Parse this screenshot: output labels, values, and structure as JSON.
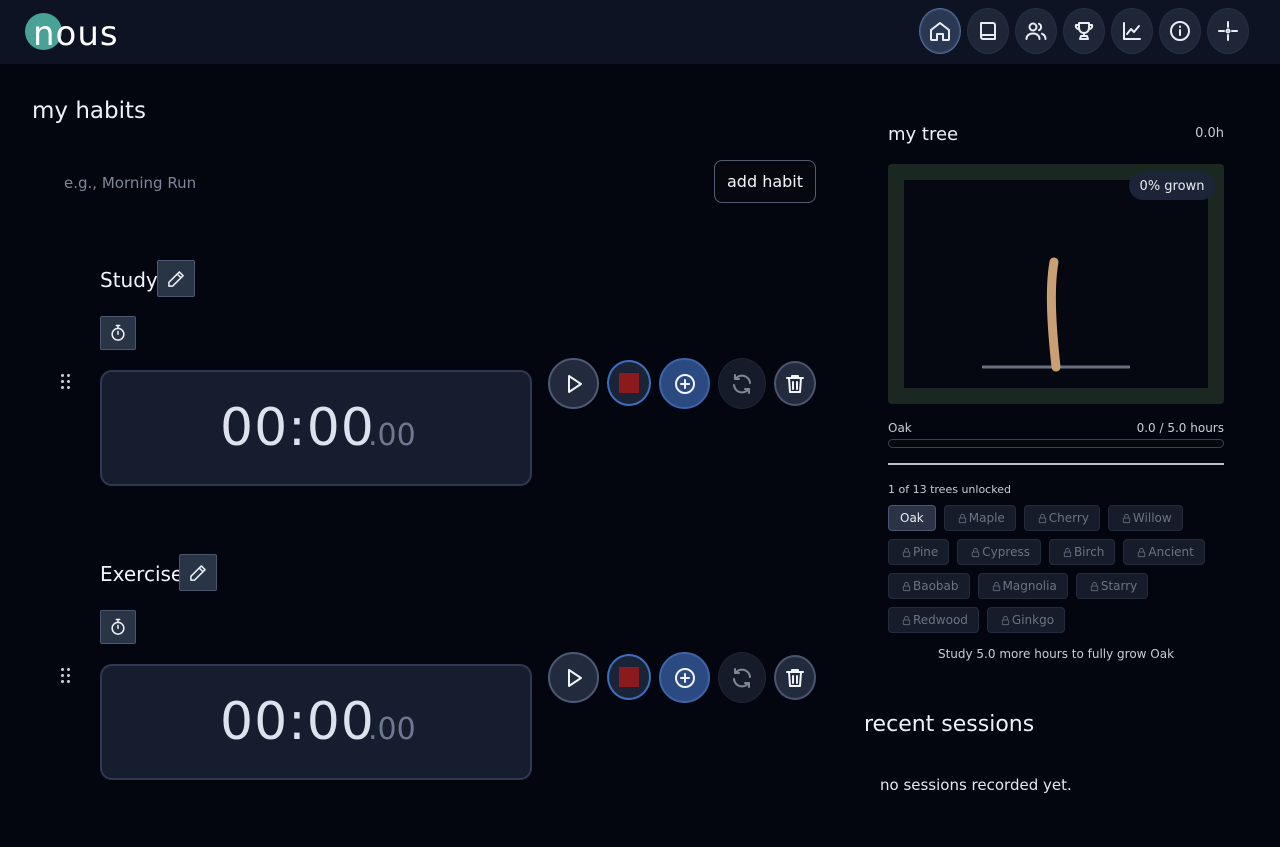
{
  "app": {
    "logo": "nous",
    "accent": "#4fb3a3"
  },
  "nav": [
    {
      "id": "home",
      "icon": "home-icon",
      "active": true
    },
    {
      "id": "journal",
      "icon": "book-icon",
      "active": false
    },
    {
      "id": "friends",
      "icon": "users-icon",
      "active": false
    },
    {
      "id": "achievements",
      "icon": "trophy-icon",
      "active": false
    },
    {
      "id": "stats",
      "icon": "chart-icon",
      "active": false
    },
    {
      "id": "about",
      "icon": "info-icon",
      "active": false
    },
    {
      "id": "focus",
      "icon": "sparkle-icon",
      "active": false
    }
  ],
  "habits_section": {
    "title": "my habits",
    "input_placeholder": "e.g., Morning Run",
    "input_value": "",
    "add_label": "add habit"
  },
  "habits": [
    {
      "name": "Study",
      "time_main": "00:00",
      "time_ms": ".00"
    },
    {
      "name": "Exercise",
      "time_main": "00:00",
      "time_ms": ".00"
    }
  ],
  "tree": {
    "title": "my tree",
    "hours": "0.0h",
    "grown": "0% grown",
    "grown_fraction": 0.0,
    "name": "Oak",
    "progress_text": "0.0 / 5.0 hours",
    "progress_fraction": 0.0,
    "unlocked_text": "1 of 13 trees unlocked",
    "species": [
      {
        "name": "Oak",
        "locked": false
      },
      {
        "name": "Maple",
        "locked": true
      },
      {
        "name": "Cherry",
        "locked": true
      },
      {
        "name": "Willow",
        "locked": true
      },
      {
        "name": "Pine",
        "locked": true
      },
      {
        "name": "Cypress",
        "locked": true
      },
      {
        "name": "Birch",
        "locked": true
      },
      {
        "name": "Ancient",
        "locked": true
      },
      {
        "name": "Baobab",
        "locked": true
      },
      {
        "name": "Magnolia",
        "locked": true
      },
      {
        "name": "Starry",
        "locked": true
      },
      {
        "name": "Redwood",
        "locked": true
      },
      {
        "name": "Ginkgo",
        "locked": true
      }
    ],
    "hint": "Study 5.0 more hours to fully grow Oak"
  },
  "recent": {
    "title": "recent sessions",
    "empty_text": "no sessions recorded yet."
  }
}
